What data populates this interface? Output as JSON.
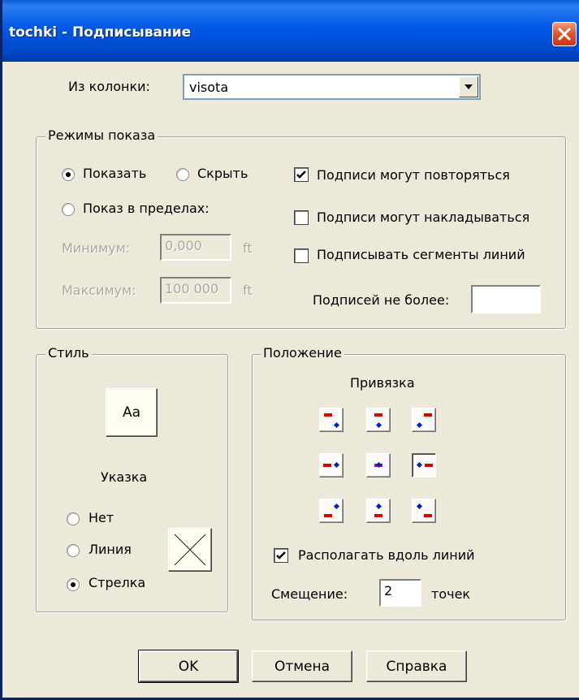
{
  "window": {
    "title": "tochki - Подписывание"
  },
  "column": {
    "label": "Из колонки:",
    "value": "visota"
  },
  "display_modes": {
    "title": "Режимы показа",
    "show_label": "Показать",
    "hide_label": "Скрыть",
    "range_label": "Показ в пределах:",
    "min_label": "Минимум:",
    "min_value": "0,000",
    "min_unit": "ft",
    "max_label": "Максимум:",
    "max_value": "100 000",
    "max_unit": "ft",
    "repeat_label": "Подписи могут повторяться",
    "repeat_checked": true,
    "overlap_label": "Подписи могут накладываться",
    "overlap_checked": false,
    "segments_label": "Подписывать сегменты линий",
    "segments_checked": false,
    "max_labels_label": "Подписей не более:",
    "max_labels_value": ""
  },
  "style": {
    "title": "Стиль",
    "font_button": "Aa",
    "pointer_label": "Указка",
    "none_label": "Нет",
    "line_label": "Линия",
    "arrow_label": "Стрелка",
    "selected": "Стрелка"
  },
  "position": {
    "title": "Положение",
    "anchor_label": "Привязка",
    "selected_anchor": "right",
    "along_lines_label": "Располагать вдоль линий",
    "along_lines_checked": true,
    "offset_label": "Смещение:",
    "offset_value": "2",
    "offset_unit": "точек"
  },
  "buttons": {
    "ok": "OK",
    "cancel": "Отмена",
    "help": "Справка"
  },
  "colors": {
    "title_bar": "#0058e6",
    "window_bg": "#ece9d8",
    "anchor_box": "#e00000",
    "anchor_point": "#0020c0"
  }
}
